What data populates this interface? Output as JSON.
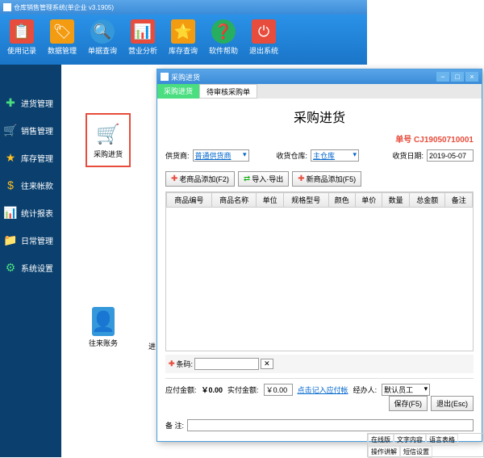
{
  "main": {
    "title": "仓库销售管理系统(单企业 v3.1905)"
  },
  "toolbar": [
    {
      "label": "使用记录",
      "icon": "📋"
    },
    {
      "label": "数据管理",
      "icon": "🏷"
    },
    {
      "label": "单据查询",
      "icon": "🔍"
    },
    {
      "label": "营业分析",
      "icon": "📊"
    },
    {
      "label": "库存查询",
      "icon": "⭐"
    },
    {
      "label": "软件帮助",
      "icon": "❓"
    },
    {
      "label": "退出系统",
      "icon": "⏻"
    }
  ],
  "sidebar": [
    {
      "label": "进货管理",
      "icon": "✚",
      "cls": "si-green"
    },
    {
      "label": "销售管理",
      "icon": "🛒",
      "cls": "si-orange"
    },
    {
      "label": "库存管理",
      "icon": "★",
      "cls": "si-yellow"
    },
    {
      "label": "往来帐款",
      "icon": "$",
      "cls": "si-dollar"
    },
    {
      "label": "统计报表",
      "icon": "📊",
      "cls": "si-bar"
    },
    {
      "label": "日常管理",
      "icon": "📁",
      "cls": "si-orange"
    },
    {
      "label": "系统设置",
      "icon": "⚙",
      "cls": "si-green"
    }
  ],
  "canvas": {
    "item1": {
      "label": "采购进货",
      "icon": "🛒"
    },
    "item2": {
      "label": "往来账务",
      "icon": "👤"
    },
    "item3": {
      "prefix": "进"
    }
  },
  "modal": {
    "title": "采购进货",
    "tabs": [
      "采购进货",
      "待审核采购单"
    ],
    "form_title": "采购进货",
    "order_label": "单号",
    "order_num": "CJ19050710001",
    "supplier_label": "供货商:",
    "supplier_value": "普通供货商",
    "warehouse_label": "收货仓库:",
    "warehouse_value": "主仓库",
    "date_label": "收货日期:",
    "date_value": "2019-05-07",
    "btn_add_old": "老商品添加(F2)",
    "btn_import": "导入·导出",
    "btn_add_new": "新商品添加(F5)",
    "columns": [
      "商品编号",
      "商品名称",
      "单位",
      "规格型号",
      "颜色",
      "单价",
      "数量",
      "总金额",
      "备注"
    ],
    "barcode_label": "条码:",
    "total_payable_label": "应付金额:",
    "total_payable": "￥0.00",
    "actual_paid_label": "实付金额:",
    "actual_paid": "￥0.00",
    "auto_store_label": "点击记入应付帐",
    "operator_label": "经办人:",
    "operator_value": "默认员工",
    "remark_label": "备   注:",
    "btn_save": "保存(F5)",
    "btn_exit": "退出(Esc)"
  },
  "status": {
    "items": [
      "在线版",
      "文字内容",
      "语言表格",
      "操作讲解",
      "短信设置"
    ]
  }
}
